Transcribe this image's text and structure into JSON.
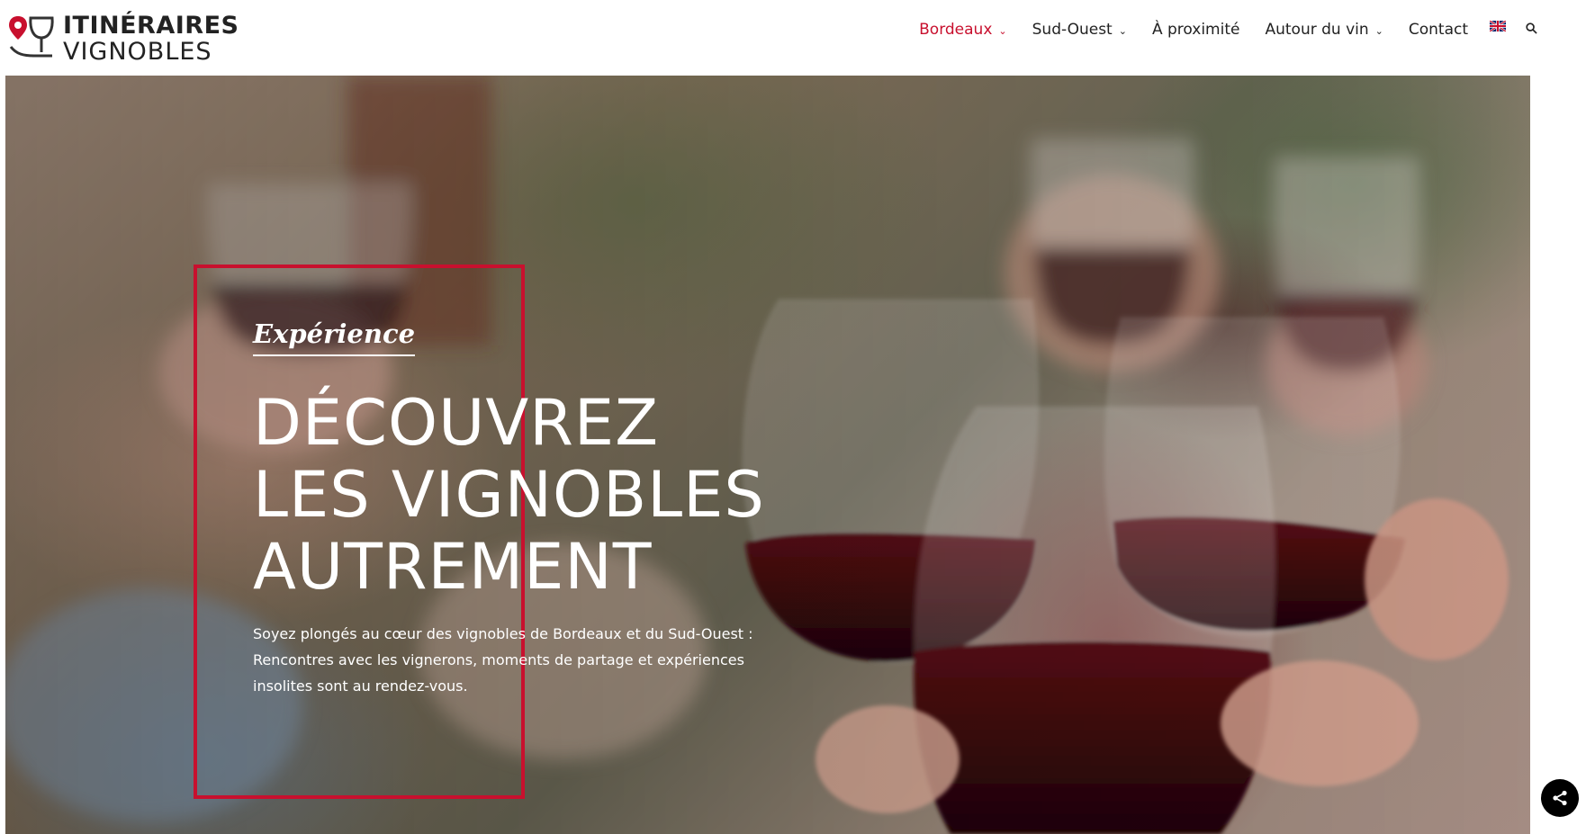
{
  "header": {
    "logo": {
      "line1": "ITINÉRAIRES",
      "line2": "VIGNOBLES"
    },
    "nav": [
      {
        "label": "Bordeaux",
        "active": true,
        "dropdown": true
      },
      {
        "label": "Sud-Ouest",
        "active": false,
        "dropdown": true
      },
      {
        "label": "À proximité",
        "active": false,
        "dropdown": false
      },
      {
        "label": "Autour du vin",
        "active": false,
        "dropdown": true
      },
      {
        "label": "Contact",
        "active": false,
        "dropdown": false
      }
    ],
    "chevron": "⌄",
    "language_icon": "uk-flag-icon",
    "search_icon": "search-icon"
  },
  "hero": {
    "eyebrow": "Expérience",
    "headline": [
      "DÉCOUVREZ",
      "LES VIGNOBLES",
      "AUTREMENT"
    ],
    "subtext": "Soyez plongés au cœur des vignobles de Bordeaux et du Sud-Ouest : Rencontres avec les vignerons, moments de partage et expériences insolites sont au rendez-vous."
  },
  "share_icon": "share-icon",
  "colors": {
    "accent": "#c8102e",
    "text": "#222222",
    "white": "#ffffff"
  }
}
